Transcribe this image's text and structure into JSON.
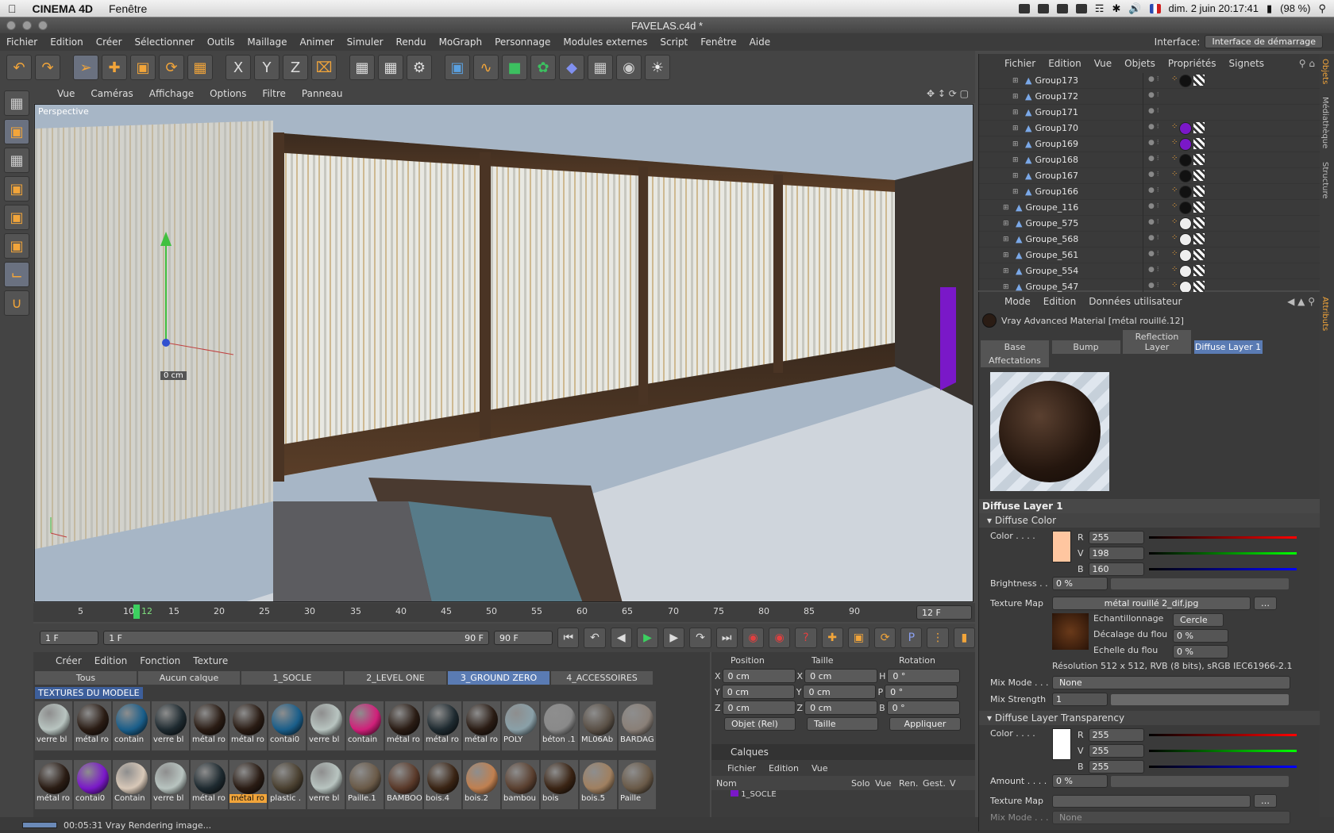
{
  "macbar": {
    "app": "CINEMA 4D",
    "menus": [
      "Fenêtre"
    ],
    "datetime": "dim. 2 juin  20:17:41",
    "battery": "(98 %)"
  },
  "window_title": "FAVELAS.c4d *",
  "app_menu": [
    "Fichier",
    "Edition",
    "Créer",
    "Sélectionner",
    "Outils",
    "Maillage",
    "Animer",
    "Simuler",
    "Rendu",
    "MoGraph",
    "Personnage",
    "Modules externes",
    "Script",
    "Fenêtre",
    "Aide"
  ],
  "interface": {
    "label": "Interface:",
    "value": "Interface de démarrage"
  },
  "viewport_menu": [
    "Vue",
    "Caméras",
    "Affichage",
    "Options",
    "Filtre",
    "Panneau"
  ],
  "viewport": {
    "label": "Perspective",
    "readout": "0 cm"
  },
  "timeline": {
    "ticks": [
      "5",
      "10",
      "12",
      "15",
      "20",
      "25",
      "30",
      "35",
      "40",
      "45",
      "50",
      "55",
      "60",
      "65",
      "70",
      "75",
      "80",
      "85",
      "90"
    ],
    "current_frame_field": "12 F",
    "start_field": "1 F",
    "range_start": "1 F",
    "range_end": "90 F",
    "end_field": "90 F"
  },
  "material_manager": {
    "menu": [
      "Créer",
      "Edition",
      "Fonction",
      "Texture"
    ],
    "tabs": [
      "Tous",
      "Aucun calque",
      "1_SOCLE",
      "2_LEVEL ONE",
      "3_GROUND ZERO",
      "4_ACCESSOIRES"
    ],
    "active_tab": "3_GROUND ZERO",
    "section_label": "TEXTURES DU MODELE",
    "materials": [
      {
        "name": "verre bl",
        "color": "#b8c4c0"
      },
      {
        "name": "métal ro",
        "color": "#2a1c14"
      },
      {
        "name": "contain",
        "color": "#1a5e8a"
      },
      {
        "name": "verre bl",
        "color": "#1e2a30"
      },
      {
        "name": "métal ro",
        "color": "#2a1c14"
      },
      {
        "name": "métal ro",
        "color": "#2a1c14"
      },
      {
        "name": "contai0",
        "color": "#1a5e8a"
      },
      {
        "name": "verre bl",
        "color": "#b8c4c0"
      },
      {
        "name": "contain",
        "color": "#d0207a"
      },
      {
        "name": "métal ro",
        "color": "#2a1c14"
      },
      {
        "name": "métal ro",
        "color": "#1e2a30"
      },
      {
        "name": "métal ro",
        "color": "#2a1c14"
      },
      {
        "name": "POLY",
        "color": "#8aa0a8"
      },
      {
        "name": "béton .1",
        "color": "#8a8a8a"
      },
      {
        "name": "ML06Ab",
        "color": "#5a5046"
      },
      {
        "name": "BARDAG",
        "color": "#8a8078"
      },
      {
        "name": "métal ro",
        "color": "#2a1c14"
      },
      {
        "name": "contai0",
        "color": "#7a18c8"
      },
      {
        "name": "Contain",
        "color": "#d8c8b8"
      },
      {
        "name": "verre bl",
        "color": "#b8c4c0"
      },
      {
        "name": "métal ro",
        "color": "#1e2a30"
      },
      {
        "name": "métal ro",
        "color": "#2a1c14"
      },
      {
        "name": "plastic .",
        "color": "#4a4030"
      },
      {
        "name": "verre bl",
        "color": "#b8c4c0"
      },
      {
        "name": "Paille.1",
        "color": "#6a5a48"
      },
      {
        "name": "BAMBOO",
        "color": "#5a3a2a"
      },
      {
        "name": "bois.4",
        "color": "#3a2414"
      },
      {
        "name": "bois.2",
        "color": "#c08050"
      },
      {
        "name": "bambou",
        "color": "#5a4030"
      },
      {
        "name": "bois",
        "color": "#3a2414"
      },
      {
        "name": "bois.5",
        "color": "#a08060"
      },
      {
        "name": "Paille",
        "color": "#6a5a48"
      }
    ],
    "selected_material": "métal ro"
  },
  "coordinates": {
    "headers": [
      "Position",
      "Taille",
      "Rotation"
    ],
    "rows": [
      {
        "a": "X",
        "av": "0 cm",
        "b": "X",
        "bv": "0 cm",
        "c": "H",
        "cv": "0 °"
      },
      {
        "a": "Y",
        "av": "0 cm",
        "b": "Y",
        "bv": "0 cm",
        "c": "P",
        "cv": "0 °"
      },
      {
        "a": "Z",
        "av": "0 cm",
        "b": "Z",
        "bv": "0 cm",
        "c": "B",
        "cv": "0 °"
      }
    ],
    "mode": "Objet (Rel)",
    "size_mode": "Taille",
    "apply": "Appliquer"
  },
  "layers": {
    "title": "Calques",
    "menu": [
      "Fichier",
      "Edition",
      "Vue"
    ],
    "columns": [
      "Nom",
      "Solo",
      "Vue",
      "Ren.",
      "Gest.",
      "V"
    ],
    "row": "1_SOCLE"
  },
  "status": "00:05:31 Vray Rendering image...",
  "objects_panel": {
    "menu": [
      "Fichier",
      "Edition",
      "Vue",
      "Objets",
      "Propriétés",
      "Signets"
    ],
    "rows": [
      {
        "name": "Group173",
        "tag": "#111111",
        "indent": 3
      },
      {
        "name": "Group172",
        "tag": "",
        "indent": 3
      },
      {
        "name": "Group171",
        "tag": "",
        "indent": 3
      },
      {
        "name": "Group170",
        "tag": "#7a18c8",
        "indent": 3
      },
      {
        "name": "Group169",
        "tag": "#7a18c8",
        "indent": 3
      },
      {
        "name": "Group168",
        "tag": "#111111",
        "indent": 3
      },
      {
        "name": "Group167",
        "tag": "#111111",
        "indent": 3
      },
      {
        "name": "Group166",
        "tag": "#111111",
        "indent": 3
      },
      {
        "name": "Groupe_116",
        "tag": "#111111",
        "indent": 2
      },
      {
        "name": "Groupe_575",
        "tag": "#eeeeee",
        "indent": 2
      },
      {
        "name": "Groupe_568",
        "tag": "#eeeeee",
        "indent": 2
      },
      {
        "name": "Groupe_561",
        "tag": "#eeeeee",
        "indent": 2
      },
      {
        "name": "Groupe_554",
        "tag": "#eeeeee",
        "indent": 2
      },
      {
        "name": "Groupe_547",
        "tag": "#eeeeee",
        "indent": 2
      }
    ]
  },
  "attributes": {
    "menu": [
      "Mode",
      "Edition",
      "Données utilisateur"
    ],
    "material_title": "Vray Advanced Material [métal rouillé.12]",
    "tabs": [
      "Base",
      "Bump",
      "Reflection Layer",
      "Diffuse Layer 1",
      "Affectations"
    ],
    "active_tab": "Diffuse Layer 1",
    "section": "Diffuse Layer 1",
    "diffuse_color": {
      "title": "Diffuse Color",
      "color_label": "Color . . . .",
      "swatch": "#ffc6a0",
      "r_label": "R",
      "r": "255",
      "v_label": "V",
      "v": "198",
      "b_label": "B",
      "b": "160",
      "brightness_label": "Brightness . .",
      "brightness": "0 %",
      "texture_label": "Texture Map",
      "texture": "métal rouillé 2_dif.jpg",
      "sampling_label": "Echantillonnage",
      "sampling": "Cercle",
      "blur_offset_label": "Décalage du flou",
      "blur_offset": "0 %",
      "blur_scale_label": "Echelle du flou",
      "blur_scale": "0 %",
      "resolution": "Résolution 512 x 512, RVB (8 bits), sRGB IEC61966-2.1",
      "mix_mode_label": "Mix Mode . . .",
      "mix_mode": "None",
      "mix_strength_label": "Mix Strength",
      "mix_strength": "1"
    },
    "transparency": {
      "title": "Diffuse Layer Transparency",
      "color_label": "Color . . . .",
      "swatch": "#ffffff",
      "r": "255",
      "v": "255",
      "b": "255",
      "amount_label": "Amount . . . .",
      "amount": "0 %",
      "texture_label": "Texture Map",
      "mix_mode_label": "Mix Mode . . .",
      "mix_mode": "None"
    }
  },
  "side_tabs": [
    "Objets",
    "Médiathèque",
    "Structure",
    "Attributs"
  ],
  "colors": {
    "accent": "#f2a53a",
    "selection": "#5a7bb3"
  }
}
